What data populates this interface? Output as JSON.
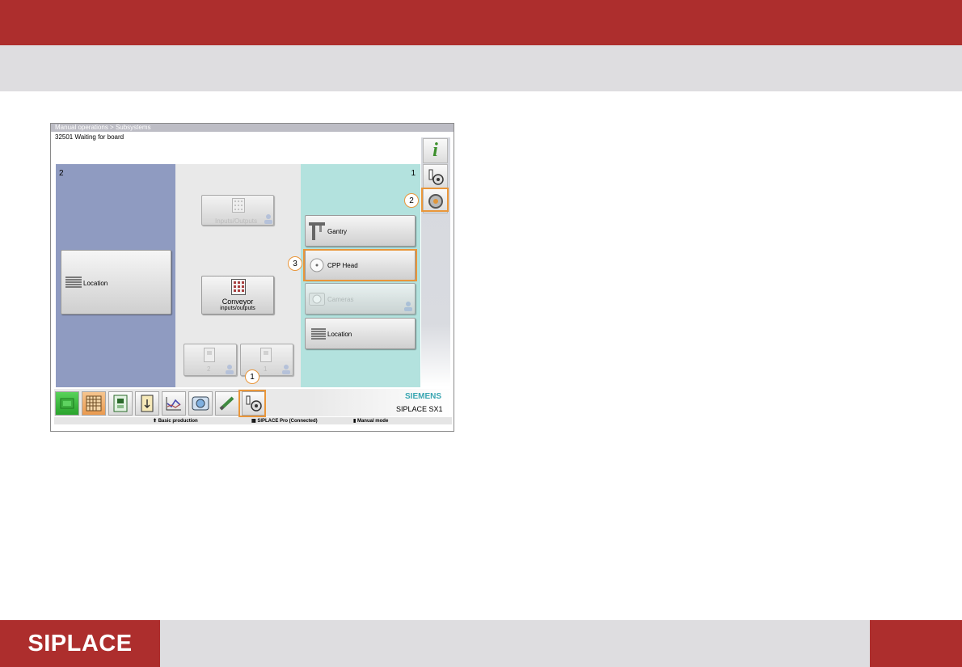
{
  "header": {
    "brand_color": "#ad2e2d"
  },
  "screen": {
    "breadcrumb": "Manual operations > Subsystems",
    "status": "32501 Waiting for board",
    "panel_left": {
      "number": "2",
      "color": "#8f9bc1",
      "location_label": "Location"
    },
    "panel_middle": {
      "io_label": "Inputs/Outputs",
      "conveyor_line1": "Conveyor",
      "conveyor_line2": "inputs/outputs",
      "small_left": "2",
      "small_right": "1"
    },
    "panel_right": {
      "number": "1",
      "color": "#b3e2de",
      "items": [
        {
          "label": "Gantry",
          "icon": "gantry-icon",
          "enabled": true
        },
        {
          "label": "CPP Head",
          "icon": "head-icon",
          "enabled": true
        },
        {
          "label": "Cameras",
          "icon": "camera-icon",
          "enabled": false
        },
        {
          "label": "Location",
          "icon": "list-icon",
          "enabled": true
        }
      ]
    },
    "sidebar": [
      {
        "icon": "info-icon"
      },
      {
        "icon": "hand-gear-icon"
      },
      {
        "icon": "gear-icon"
      }
    ],
    "taskbar": [
      {
        "icon": "stack-icon"
      },
      {
        "icon": "grid-icon"
      },
      {
        "icon": "board-icon"
      },
      {
        "icon": "feeder-icon"
      },
      {
        "icon": "chart-icon"
      },
      {
        "icon": "camera-icon"
      },
      {
        "icon": "nozzle-icon"
      },
      {
        "icon": "hand-gear-icon"
      }
    ],
    "logo": "SIEMENS",
    "model": "SIPLACE SX1",
    "footer": {
      "mode": "Basic production",
      "server": "SIPLACE Pro (Connected)",
      "manual": "Manual mode"
    },
    "callouts": [
      "1",
      "2",
      "3"
    ],
    "highlight_color": "#e9963a"
  },
  "footer": {
    "brand": "SIPLACE"
  }
}
